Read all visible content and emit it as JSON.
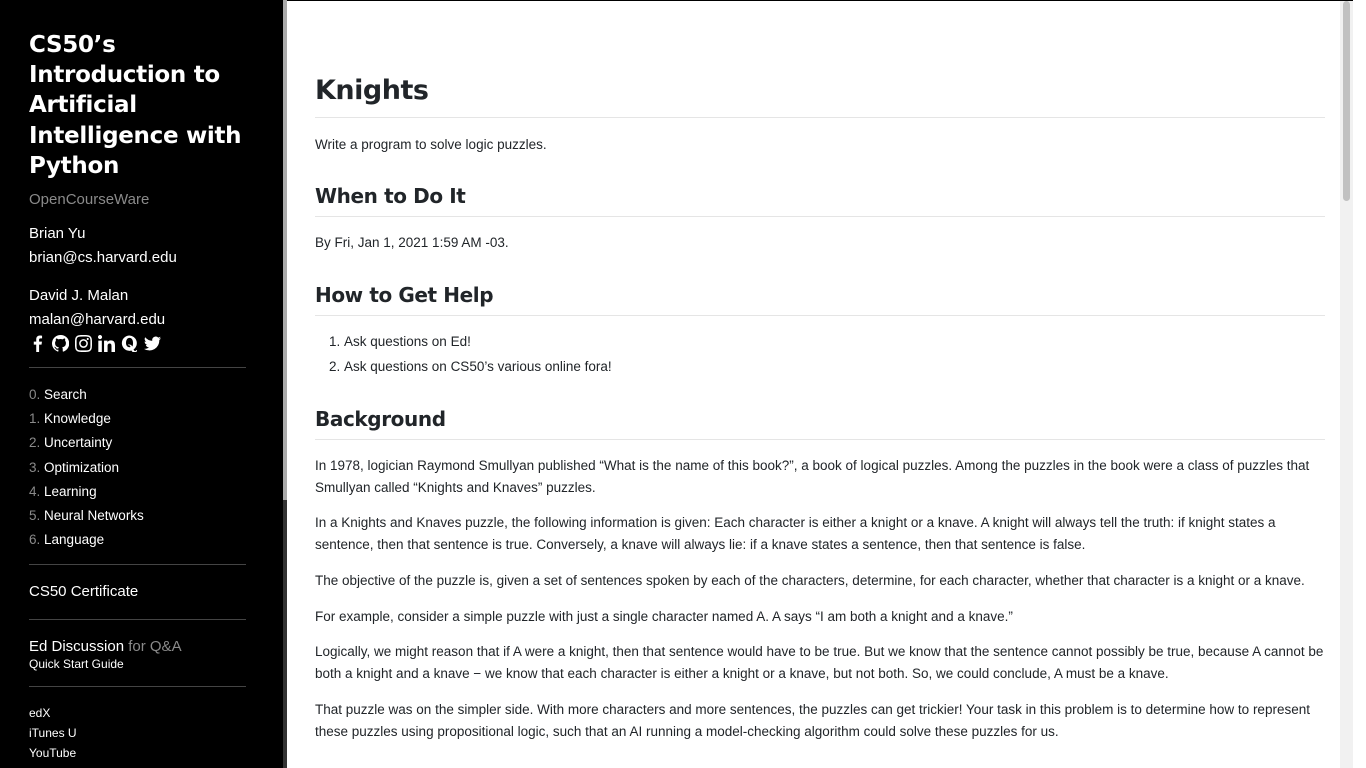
{
  "sidebar": {
    "course_title": "CS50’s Introduction to Artificial Intelligence with Python",
    "ocw": "OpenCourseWare",
    "instructors": [
      {
        "name": "Brian Yu",
        "email": "brian@cs.harvard.edu"
      },
      {
        "name": "David J. Malan",
        "email": "malan@harvard.edu"
      }
    ],
    "social_icons": [
      "facebook-icon",
      "github-icon",
      "instagram-icon",
      "linkedin-icon",
      "quora-icon",
      "twitter-icon"
    ],
    "nav": [
      {
        "num": "0.",
        "label": "Search"
      },
      {
        "num": "1.",
        "label": "Knowledge"
      },
      {
        "num": "2.",
        "label": "Uncertainty"
      },
      {
        "num": "3.",
        "label": "Optimization"
      },
      {
        "num": "4.",
        "label": "Learning"
      },
      {
        "num": "5.",
        "label": "Neural Networks"
      },
      {
        "num": "6.",
        "label": "Language"
      }
    ],
    "certificate": "CS50 Certificate",
    "ed_label": "Ed Discussion",
    "ed_suffix": "for Q&A",
    "quick_start": "Quick Start Guide",
    "extras": [
      "edX",
      "iTunes U",
      "YouTube"
    ]
  },
  "main": {
    "title": "Knights",
    "subtitle": "Write a program to solve logic puzzles.",
    "when_heading": "When to Do It",
    "when_text": "By Fri, Jan 1, 2021 1:59 AM -03.",
    "help_heading": "How to Get Help",
    "help_items": [
      "Ask questions on Ed!",
      "Ask questions on CS50’s various online fora!"
    ],
    "background_heading": "Background",
    "paragraphs": [
      "In 1978, logician Raymond Smullyan published “What is the name of this book?”, a book of logical puzzles. Among the puzzles in the book were a class of puzzles that Smullyan called “Knights and Knaves” puzzles.",
      "In a Knights and Knaves puzzle, the following information is given: Each character is either a knight or a knave. A knight will always tell the truth: if knight states a sentence, then that sentence is true. Conversely, a knave will always lie: if a knave states a sentence, then that sentence is false.",
      "The objective of the puzzle is, given a set of sentences spoken by each of the characters, determine, for each character, whether that character is a knight or a knave.",
      "For example, consider a simple puzzle with just a single character named A. A says “I am both a knight and a knave.”",
      "Logically, we might reason that if A were a knight, then that sentence would have to be true. But we know that the sentence cannot possibly be true, because A cannot be both a knight and a knave − we know that each character is either a knight or a knave, but not both. So, we could conclude, A must be a knave.",
      "That puzzle was on the simpler side. With more characters and more sentences, the puzzles can get trickier! Your task in this problem is to determine how to represent these puzzles using propositional logic, such that an AI running a model-checking algorithm could solve these puzzles for us."
    ]
  },
  "colors": {
    "sidebar_bg": "#000000",
    "muted": "#8a8a8a",
    "text": "#212529"
  }
}
